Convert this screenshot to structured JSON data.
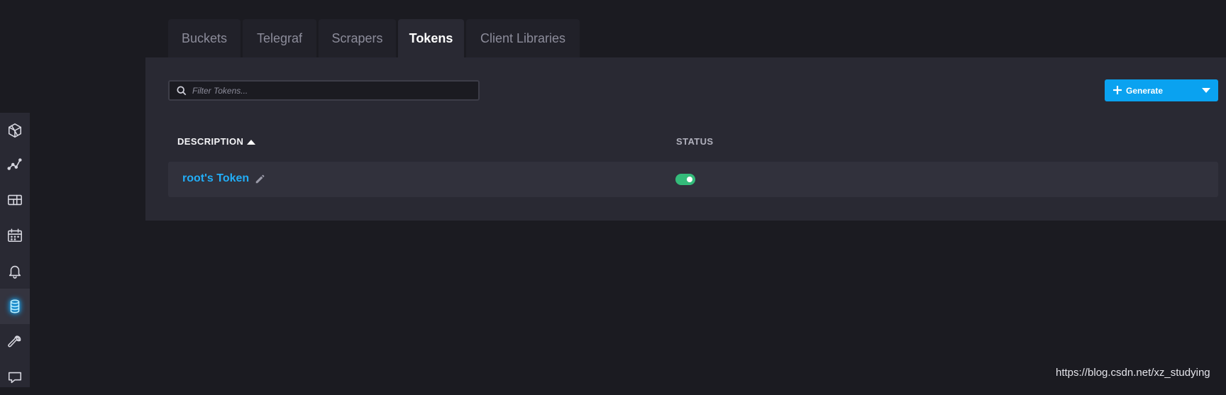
{
  "tabs": [
    {
      "label": "Buckets",
      "active": false
    },
    {
      "label": "Telegraf",
      "active": false
    },
    {
      "label": "Scrapers",
      "active": false
    },
    {
      "label": "Tokens",
      "active": true
    },
    {
      "label": "Client Libraries",
      "active": false
    }
  ],
  "sidebar": {
    "items": [
      {
        "icon": "cube-icon"
      },
      {
        "icon": "graph-icon"
      },
      {
        "icon": "table-icon"
      },
      {
        "icon": "calendar-icon"
      },
      {
        "icon": "bell-icon"
      },
      {
        "icon": "database-icon",
        "active": true
      },
      {
        "icon": "wrench-icon"
      },
      {
        "icon": "chat-icon"
      }
    ]
  },
  "filter": {
    "placeholder": "Filter Tokens...",
    "value": ""
  },
  "generate_button": {
    "label": "Generate"
  },
  "table": {
    "columns": {
      "description": "DESCRIPTION",
      "status": "STATUS"
    },
    "sort": "ascending",
    "rows": [
      {
        "description": "root's Token",
        "status_enabled": true
      }
    ]
  },
  "watermark": "https://blog.csdn.net/xz_studying",
  "colors": {
    "accent": "#22adf6",
    "button": "#0aa2f0",
    "toggle_on": "#34bb7a",
    "background": "#1b1b21",
    "panel": "#292933"
  }
}
